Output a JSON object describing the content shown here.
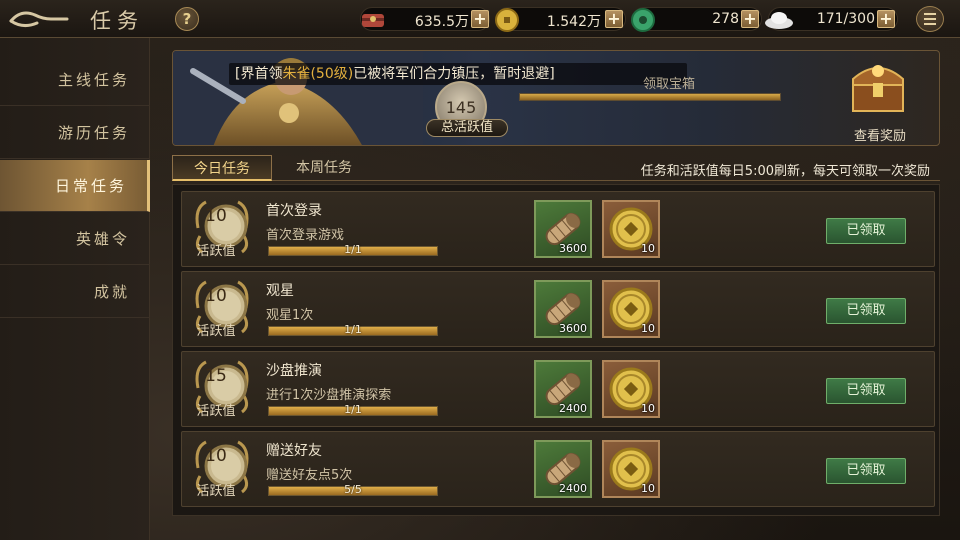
{
  "header": {
    "title": "任务",
    "help": "?",
    "resources": [
      {
        "icon": "gift-icon",
        "value": "635.5万"
      },
      {
        "icon": "gold-coin-icon",
        "value": "1.542万"
      },
      {
        "icon": "jade-icon",
        "value": "278"
      },
      {
        "icon": "silver-ingot-icon",
        "value": "171/300"
      }
    ],
    "plus": "+"
  },
  "sidebar": {
    "items": [
      {
        "label": "主线任务",
        "active": false
      },
      {
        "label": "游历任务",
        "active": false
      },
      {
        "label": "日常任务",
        "active": true
      },
      {
        "label": "英雄令",
        "active": false
      },
      {
        "label": "成就",
        "active": false
      }
    ]
  },
  "banner": {
    "news_prefix": "[界首领",
    "news_highlight": "朱雀(50级)",
    "news_suffix": "已被将军们合力镇压，暂时退避]",
    "activity_value": "145",
    "activity_label": "总活跃值",
    "box_text": "领取宝箱",
    "box_progress": 1.0,
    "view_rewards": "查看奖励"
  },
  "tabs": [
    {
      "label": "今日任务",
      "active": true
    },
    {
      "label": "本周任务",
      "active": false
    }
  ],
  "refresh_note": "任务和活跃值每日5:00刷新，每天可领取一次奖励",
  "tasks": [
    {
      "points": "10",
      "points_label": "活跃值",
      "name": "首次登录",
      "desc": "首次登录游戏",
      "progress_text": "1/1",
      "progress": 1.0,
      "scroll_count": "3600",
      "coin_count": "10",
      "status": "已领取"
    },
    {
      "points": "10",
      "points_label": "活跃值",
      "name": "观星",
      "desc": "观星1次",
      "progress_text": "1/1",
      "progress": 1.0,
      "scroll_count": "3600",
      "coin_count": "10",
      "status": "已领取"
    },
    {
      "points": "15",
      "points_label": "活跃值",
      "name": "沙盘推演",
      "desc": "进行1次沙盘推演探索",
      "progress_text": "1/1",
      "progress": 1.0,
      "scroll_count": "2400",
      "coin_count": "10",
      "status": "已领取"
    },
    {
      "points": "10",
      "points_label": "活跃值",
      "name": "赠送好友",
      "desc": "赠送好友点5次",
      "progress_text": "5/5",
      "progress": 1.0,
      "scroll_count": "2400",
      "coin_count": "10",
      "status": "已领取"
    }
  ]
}
